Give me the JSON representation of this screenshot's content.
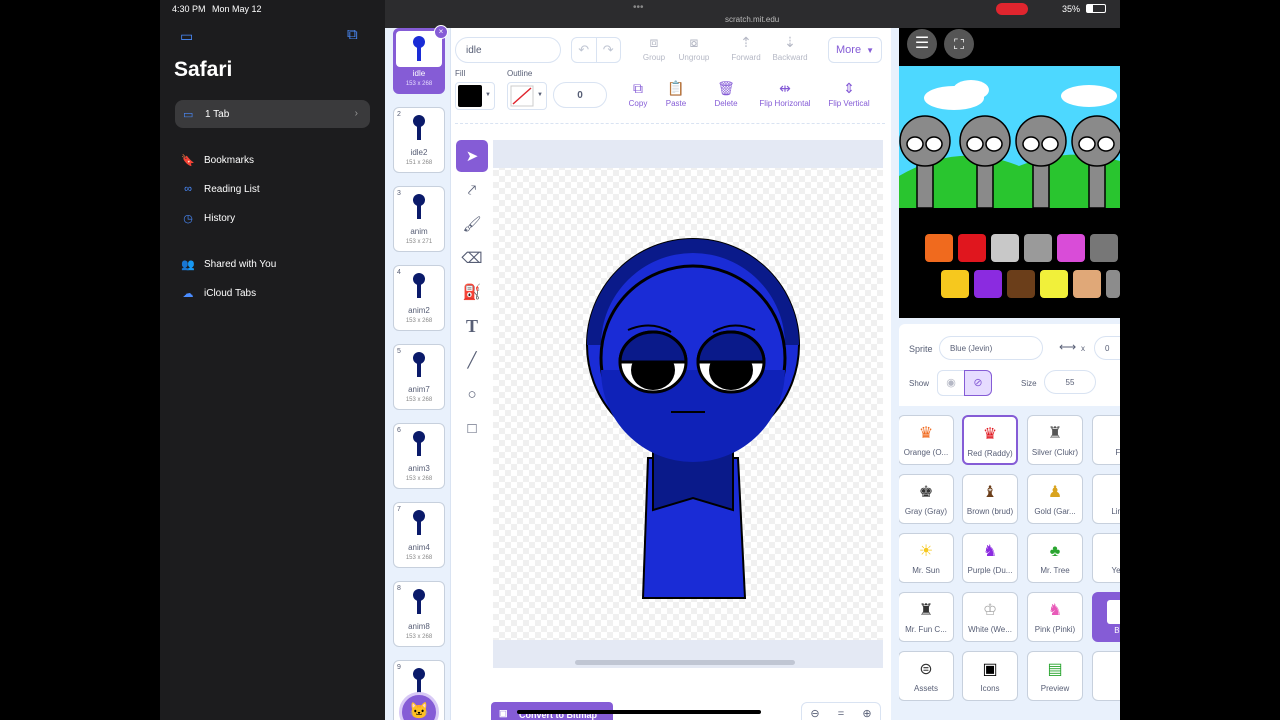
{
  "status": {
    "time": "4:30 PM",
    "date": "Mon May 12",
    "battery": "35%"
  },
  "safari": {
    "title": "Safari",
    "tab_pill": "1 Tab",
    "items": [
      "Bookmarks",
      "Reading List",
      "History",
      "Shared with You",
      "iCloud Tabs"
    ]
  },
  "url": "scratch.mit.edu",
  "costumes": [
    {
      "num": "1",
      "name": "idle",
      "size": "153 x 268"
    },
    {
      "num": "2",
      "name": "idle2",
      "size": "151 x 268"
    },
    {
      "num": "3",
      "name": "anim",
      "size": "153 x 271"
    },
    {
      "num": "4",
      "name": "anim2",
      "size": "153 x 268"
    },
    {
      "num": "5",
      "name": "anim7",
      "size": "153 x 268"
    },
    {
      "num": "6",
      "name": "anim3",
      "size": "153 x 268"
    },
    {
      "num": "7",
      "name": "anim4",
      "size": "153 x 268"
    },
    {
      "num": "8",
      "name": "anim8",
      "size": "153 x 268"
    },
    {
      "num": "9",
      "name": "",
      "size": ""
    }
  ],
  "editor": {
    "costume_name": "idle",
    "group": "Group",
    "ungroup": "Ungroup",
    "forward": "Forward",
    "backward": "Backward",
    "more": "More",
    "fill_label": "Fill",
    "outline_label": "Outline",
    "outline_width": "0",
    "copy": "Copy",
    "paste": "Paste",
    "delete": "Delete",
    "flip_h": "Flip Horizontal",
    "flip_v": "Flip Vertical",
    "convert": "Convert to Bitmap",
    "zoom_reset": "="
  },
  "sprite_info": {
    "sprite_label": "Sprite",
    "sprite_name": "Blue (Jevin)",
    "x_label": "x",
    "x_value": "0",
    "show_label": "Show",
    "size_label": "Size",
    "size_value": "55"
  },
  "sprites": [
    "Orange (O...",
    "Red (Raddy)",
    "Silver (Clukr)",
    "Fu",
    "Gray (Gray)",
    "Brown (brud)",
    "Gold (Gar...",
    "Lime",
    "Mr. Sun",
    "Purple (Du...",
    "Mr. Tree",
    "Yello",
    "Mr. Fun C...",
    "White (We...",
    "Pink (Pinki)",
    "Blu",
    "Assets",
    "Icons",
    "Preview",
    ""
  ],
  "colors": {
    "accent": "#855cd6",
    "character_blue": "#1a2cd6",
    "sky": "#4dd8ff",
    "grass": "#29c52f"
  }
}
